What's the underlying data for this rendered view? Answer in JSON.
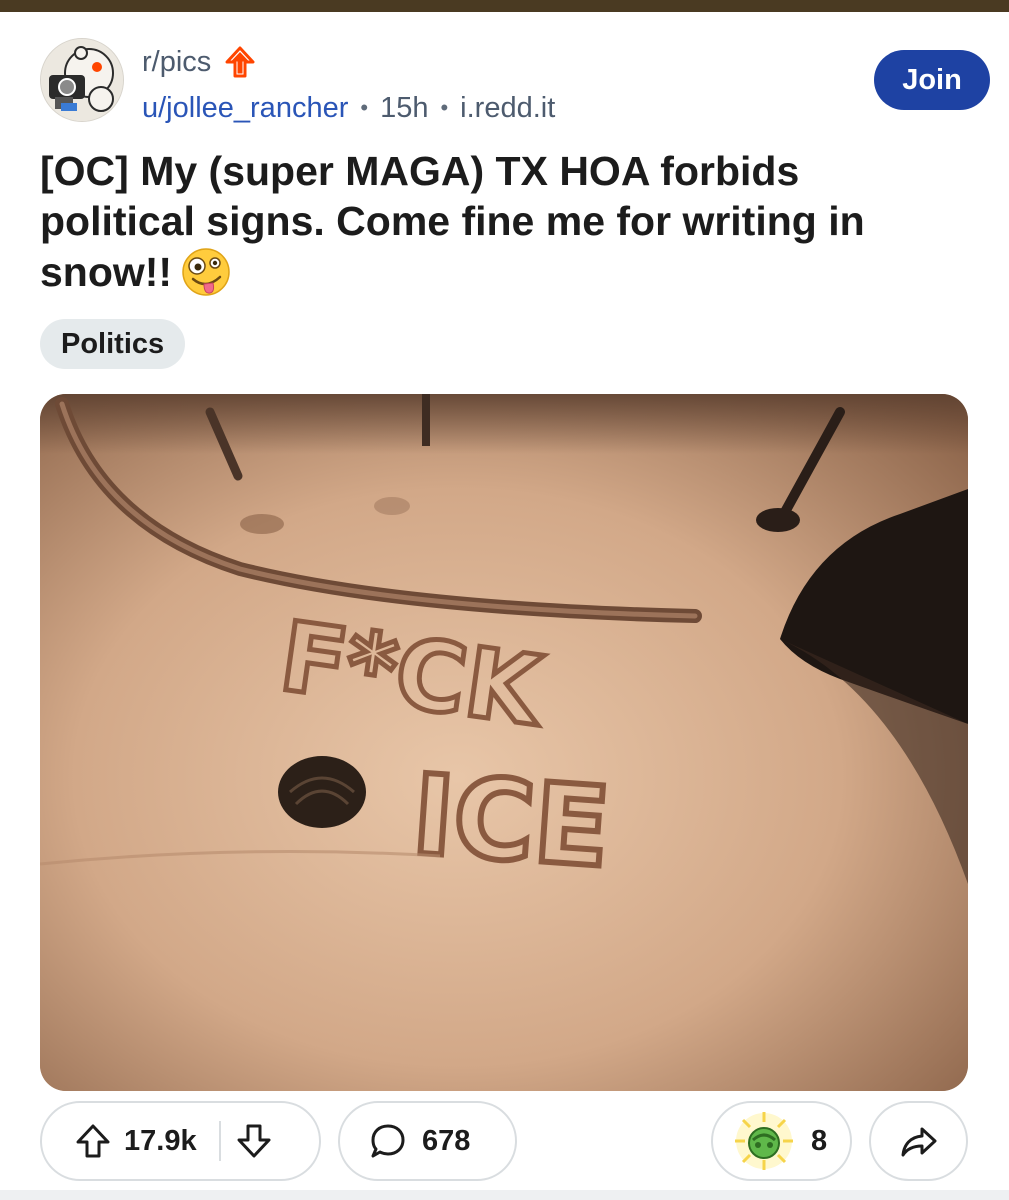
{
  "post": {
    "subreddit": "r/pics",
    "author": "u/jollee_rancher",
    "age": "15h",
    "domain": "i.redd.it",
    "join_label": "Join",
    "title": "[OC] My (super MAGA) TX HOA forbids political signs. Come fine me for writing in snow!!",
    "title_emoji": "zany-face-emoji",
    "flair": "Politics",
    "snow_text": [
      "F*CK",
      "ICE"
    ]
  },
  "actions": {
    "upvotes": "17.9k",
    "comments": "678",
    "awards": "8"
  },
  "icons": {
    "subreddit_avatar": "reddit-snoo-avatar",
    "hot_badge": "red-up-arrow-icon",
    "upvote": "upvote-arrow-icon",
    "downvote": "downvote-arrow-icon",
    "comment": "comment-bubble-icon",
    "award": "gold-award-icon",
    "share": "share-arrow-icon"
  },
  "colors": {
    "join_button": "#1e42a3",
    "username_link": "#2a55b7",
    "hot_badge": "#ff4500",
    "flair_bg": "#e5eaec"
  }
}
